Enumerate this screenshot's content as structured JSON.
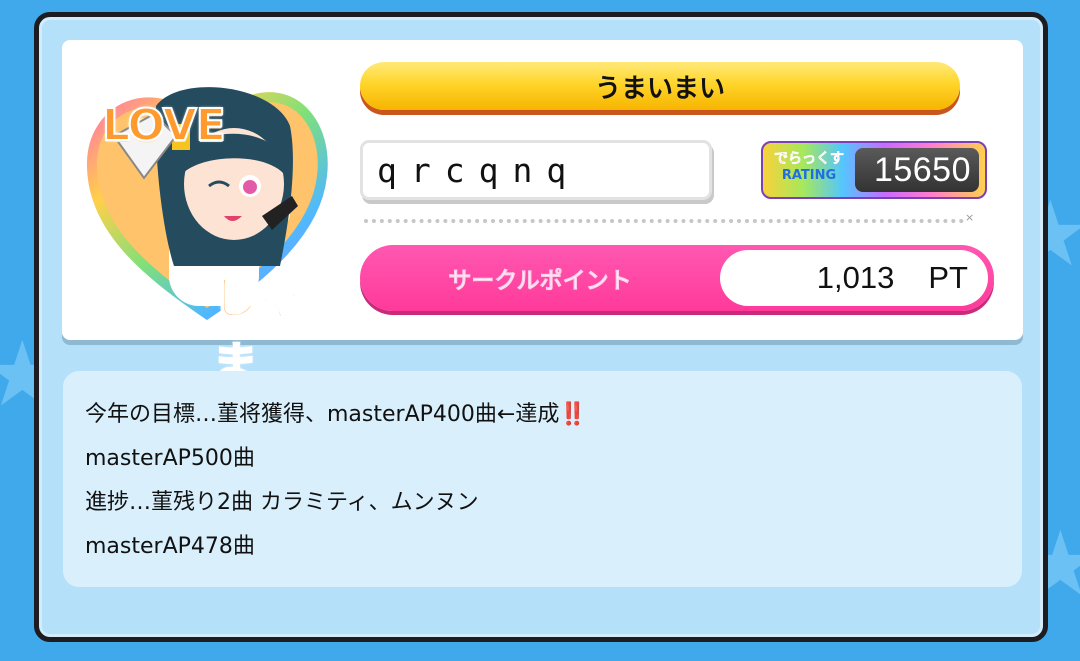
{
  "profile": {
    "title": "うまいまい",
    "player_name": "qrcqnq",
    "rating": {
      "logo_top": "でらっくす",
      "logo_bottom": "RATING",
      "value": "15650"
    },
    "circle_points": {
      "label": "サークルポイント",
      "value": "1,013",
      "unit": "PT"
    },
    "icon": {
      "name": "love-jama-icon",
      "text_top": "LOVE",
      "text_bottom": "じゃま"
    }
  },
  "comment": {
    "lines": [
      {
        "text": "今年の目標…菫将獲得、masterAP400曲←達成",
        "emoji": "‼️"
      },
      {
        "text": "masterAP500曲"
      },
      {
        "text": "進捗…菫残り2曲 カラミティ、ムンヌン"
      },
      {
        "text": "masterAP478曲"
      }
    ]
  },
  "colors": {
    "background": "#3fa9ec",
    "panel": "#b5e0fa",
    "title_bar": "#ffd52a",
    "circle_bar": "#ff3a9a",
    "comment_bg": "#d9f0fc"
  }
}
